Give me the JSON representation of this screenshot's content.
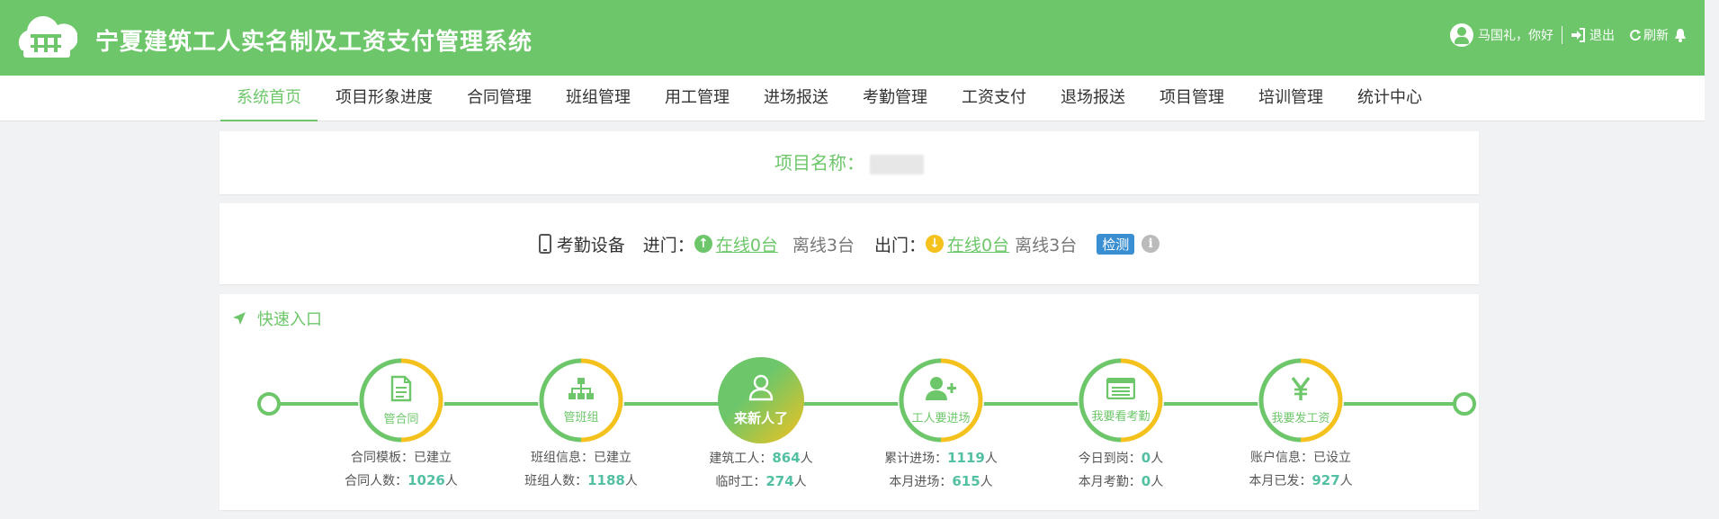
{
  "header": {
    "title": "宁夏建筑工人实名制及工资支付管理系统",
    "user_greeting": "马国礼，你好",
    "logout_label": "退出",
    "refresh_label": "刷新"
  },
  "nav": {
    "items": [
      "系统首页",
      "项目形象进度",
      "合同管理",
      "班组管理",
      "用工管理",
      "进场报送",
      "考勤管理",
      "工资支付",
      "退场报送",
      "项目管理",
      "培训管理",
      "统计中心"
    ],
    "active_index": 0
  },
  "project": {
    "label": "项目名称："
  },
  "device": {
    "label": "考勤设备",
    "entry_label": "进门：",
    "entry_online": "在线0台",
    "entry_offline": "离线3台",
    "exit_label": "出门：",
    "exit_online": "在线0台",
    "exit_offline": "离线3台",
    "check_label": "检测"
  },
  "quick_entry": {
    "title": "快速入口",
    "nodes": [
      {
        "label": "管合同",
        "icon": "document-icon",
        "line1_label": "合同模板：",
        "line1_value": "已建立",
        "line2_label": "合同人数：",
        "line2_value": "1026",
        "line2_unit": "人"
      },
      {
        "label": "管班组",
        "icon": "org-chart-icon",
        "line1_label": "班组信息：",
        "line1_value": "已建立",
        "line2_label": "班组人数：",
        "line2_value": "1188",
        "line2_unit": "人"
      },
      {
        "label": "来新人了",
        "icon": "user-icon",
        "line1_label": "建筑工人：",
        "line1_value": "864",
        "line1_unit": "人",
        "line2_label": "临时工：",
        "line2_value": "274",
        "line2_unit": "人"
      },
      {
        "label": "工人要进场",
        "icon": "user-add-icon",
        "line1_label": "累计进场：",
        "line1_value": "1119",
        "line1_unit": "人",
        "line2_label": "本月进场：",
        "line2_value": "615",
        "line2_unit": "人"
      },
      {
        "label": "我要看考勤",
        "icon": "list-icon",
        "line1_label": "今日到岗：",
        "line1_value": "0",
        "line1_unit": "人",
        "line2_label": "本月考勤：",
        "line2_value": "0",
        "line2_unit": "人"
      },
      {
        "label": "我要发工资",
        "icon": "yen-icon",
        "line1_label": "账户信息：",
        "line1_value": "已设立",
        "line2_label": "本月已发：",
        "line2_value": "927",
        "line2_unit": "人"
      }
    ]
  },
  "colors": {
    "brand_green": "#6dc76a",
    "accent_yellow": "#f4c11d",
    "stat_teal": "#53c0a3",
    "badge_blue": "#3a8fd2"
  }
}
